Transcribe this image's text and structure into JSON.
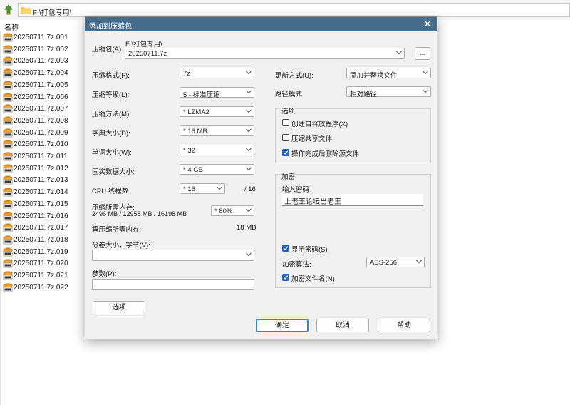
{
  "explorer": {
    "path": "F:\\打包专用\\",
    "column_name": "名称",
    "files": [
      "20250711.7z.001",
      "20250711.7z.002",
      "20250711.7z.003",
      "20250711.7z.004",
      "20250711.7z.005",
      "20250711.7z.006",
      "20250711.7z.007",
      "20250711.7z.008",
      "20250711.7z.009",
      "20250711.7z.010",
      "20250711.7z.011",
      "20250711.7z.012",
      "20250711.7z.013",
      "20250711.7z.014",
      "20250711.7z.015",
      "20250711.7z.016",
      "20250711.7z.017",
      "20250711.7z.018",
      "20250711.7z.019",
      "20250711.7z.020",
      "20250711.7z.021",
      "20250711.7z.022"
    ]
  },
  "dialog": {
    "title": "添加到压缩包",
    "archive_label": "压缩包(A)",
    "archive_dir": "F:\\打包专用\\",
    "archive_name": "20250711.7z",
    "browse_label": "...",
    "format_label": "压缩格式(F):",
    "format_value": "7z",
    "level_label": "压缩等级(L):",
    "level_value": "5 - 标准压缩",
    "method_label": "压缩方法(M):",
    "method_value": "* LZMA2",
    "dict_label": "字典大小(D):",
    "dict_value": "* 16 MB",
    "word_label": "单词大小(W):",
    "word_value": "* 32",
    "solid_label": "固实数据大小:",
    "solid_value": "* 4 GB",
    "cpu_label": "CPU 线程数:",
    "cpu_value": "* 16",
    "cpu_total": "/ 16",
    "mem_label": "压缩所需内存:",
    "mem_detail": "2496 MB / 12958 MB / 16198 MB",
    "mem_value": "* 80%",
    "decomp_label": "解压缩所需内存:",
    "decomp_value": "18 MB",
    "volume_label": "分卷大小，字节(V):",
    "volume_value": "",
    "params_label": "参数(P):",
    "params_value": "",
    "options_button": "选项",
    "update_label": "更新方式(U):",
    "update_value": "添加并替换文件",
    "pathmode_label": "路径模式",
    "pathmode_value": "相对路径",
    "options_group_title": "选项",
    "opt_sfx": {
      "label": "创建自释放程序(X)",
      "checked": false
    },
    "opt_shared": {
      "label": "压缩共享文件",
      "checked": false
    },
    "opt_delete": {
      "label": "操作完成后删除源文件",
      "checked": true
    },
    "encrypt_group_title": "加密",
    "password_label": "输入密码：",
    "password_value": "上老王论坛当老王",
    "show_password": {
      "label": "显示密码(S)",
      "checked": true
    },
    "enc_method_label": "加密算法:",
    "enc_method_value": "AES-256",
    "encrypt_names": {
      "label": "加密文件名(N)",
      "checked": true
    },
    "ok_button": "确定",
    "cancel_button": "取消",
    "help_button": "帮助"
  }
}
